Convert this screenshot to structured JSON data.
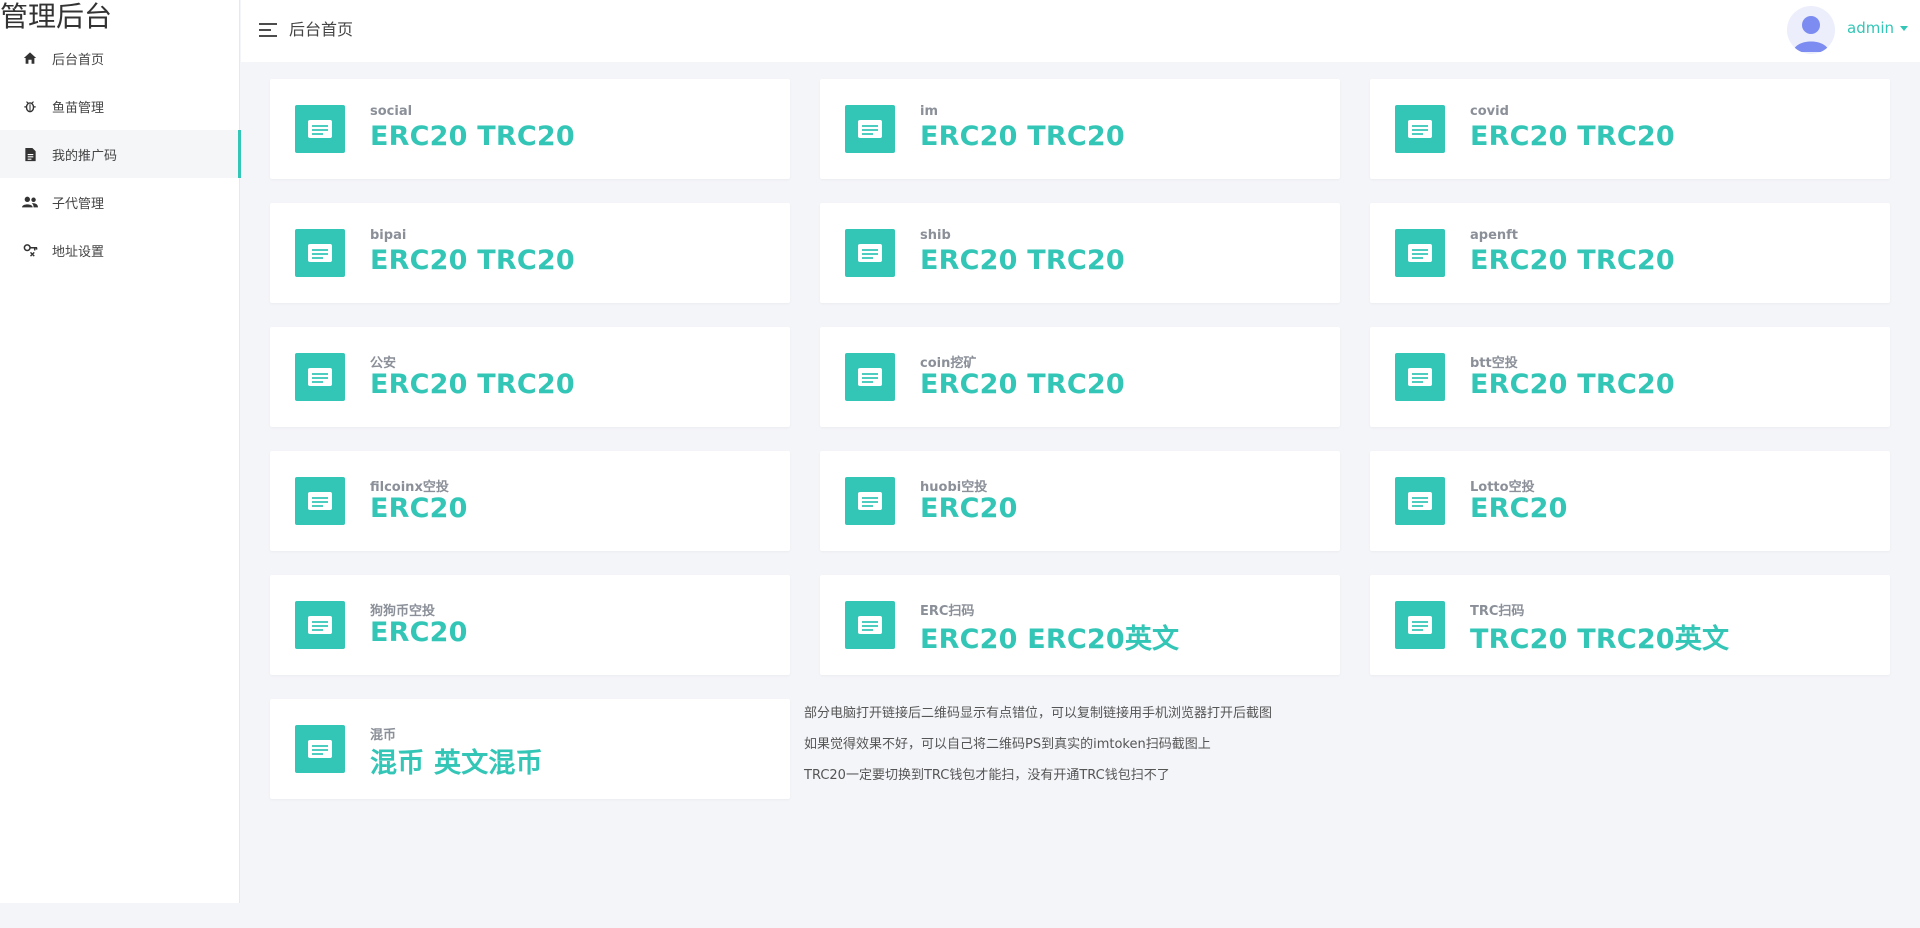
{
  "sidebar": {
    "brand": "管理后台",
    "items": [
      {
        "label": "后台首页",
        "icon": "home-icon"
      },
      {
        "label": "鱼苗管理",
        "icon": "bug-icon"
      },
      {
        "label": "我的推广码",
        "icon": "document-icon",
        "active": true
      },
      {
        "label": "子代管理",
        "icon": "users-icon"
      },
      {
        "label": "地址设置",
        "icon": "key-icon"
      }
    ]
  },
  "header": {
    "title": "后台首页",
    "username": "admin"
  },
  "cards": [
    {
      "label": "social",
      "value": "ERC20 TRC20"
    },
    {
      "label": "im",
      "value": "ERC20 TRC20"
    },
    {
      "label": "covid",
      "value": "ERC20 TRC20"
    },
    {
      "label": "bipai",
      "value": "ERC20 TRC20"
    },
    {
      "label": "shib",
      "value": "ERC20 TRC20"
    },
    {
      "label": "apenft",
      "value": "ERC20 TRC20"
    },
    {
      "label": "公安",
      "value": "ERC20 TRC20"
    },
    {
      "label": "coin挖矿",
      "value": "ERC20 TRC20"
    },
    {
      "label": "btt空投",
      "value": "ERC20 TRC20"
    },
    {
      "label": "filcoinx空投",
      "value": "ERC20"
    },
    {
      "label": "huobi空投",
      "value": "ERC20"
    },
    {
      "label": "Lotto空投",
      "value": "ERC20"
    },
    {
      "label": "狗狗币空投",
      "value": "ERC20"
    },
    {
      "label": "ERC扫码",
      "value": "ERC20 ERC20英文"
    },
    {
      "label": "TRC扫码",
      "value": "TRC20 TRC20英文"
    },
    {
      "label": "混币",
      "value": "混币 英文混币"
    }
  ],
  "notes": [
    "部分电脑打开链接后二维码显示有点错位，可以复制链接用手机浏览器打开后截图",
    "如果觉得效果不好，可以自己将二维码PS到真实的imtoken扫码截图上",
    "TRC20一定要切换到TRC钱包才能扫，没有开通TRC钱包扫不了"
  ],
  "colors": {
    "accent": "#33c6b7",
    "background": "#f4f5f9"
  }
}
